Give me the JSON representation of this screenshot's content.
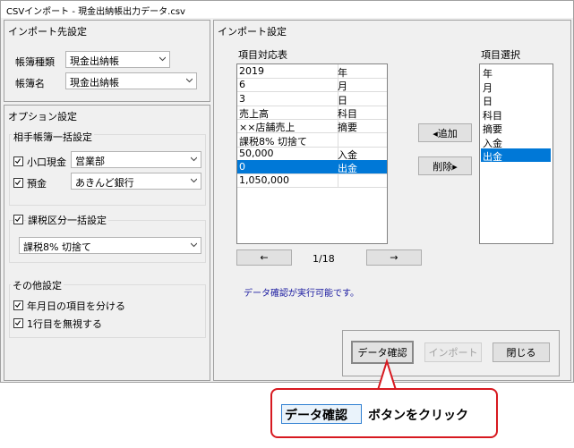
{
  "window": {
    "title": "CSVインポート - 現金出納帳出力データ.csv"
  },
  "import_dest": {
    "header": "インポート先設定",
    "book_type_label": "帳簿種類",
    "book_type_value": "現金出納帳",
    "book_name_label": "帳簿名",
    "book_name_value": "現金出納帳"
  },
  "options": {
    "header": "オプション設定",
    "counter_group": "相手帳簿一括設定",
    "petty_cash_label": "小口現金",
    "petty_cash_value": "営業部",
    "deposit_label": "預金",
    "deposit_value": "あきんど銀行",
    "tax_group": "課税区分一括設定",
    "tax_value": "課税8% 切捨て",
    "other_group": "その他設定",
    "split_date_label": "年月日の項目を分ける",
    "skip_first_label": "1行目を無視する"
  },
  "import_settings": {
    "header": "インポート設定",
    "mapping_label": "項目対応表",
    "mapping_rows": [
      {
        "value": "2019",
        "field": "年"
      },
      {
        "value": "6",
        "field": "月"
      },
      {
        "value": "3",
        "field": "日"
      },
      {
        "value": "売上高",
        "field": "科目"
      },
      {
        "value": "××店舗売上",
        "field": "摘要"
      },
      {
        "value": "課税8% 切捨て",
        "field": ""
      },
      {
        "value": "50,000",
        "field": "入金"
      },
      {
        "value": "0",
        "field": "出金"
      },
      {
        "value": "1,050,000",
        "field": ""
      }
    ],
    "selected_row": 7,
    "add_button": "◂追加",
    "remove_button": "削除▸",
    "select_label": "項目選択",
    "select_items": [
      "年",
      "月",
      "日",
      "科目",
      "摘要",
      "入金",
      "出金"
    ],
    "selected_item": 6,
    "prev_button": "←",
    "next_button": "→",
    "page_indicator": "1/18",
    "status": "データ確認が実行可能です。",
    "check_button": "データ確認",
    "import_button": "インポート",
    "close_button": "閉じる"
  },
  "callout": {
    "highlight": "データ確認",
    "text": "ボタンをクリック"
  },
  "colors": {
    "selection": "#0078d7",
    "callout_border": "#d71920",
    "status_text": "#1a1aa0"
  }
}
